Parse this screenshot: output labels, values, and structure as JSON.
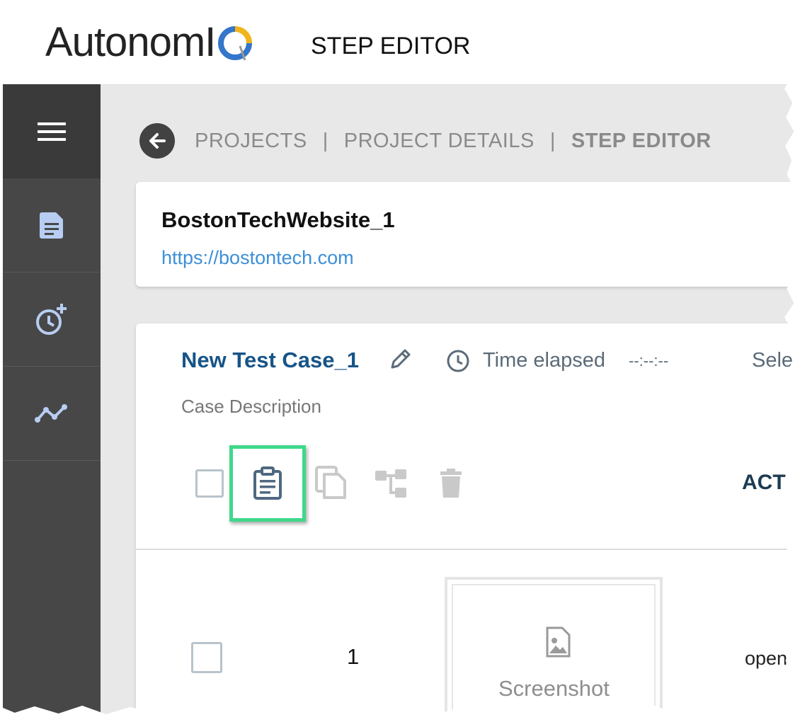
{
  "header": {
    "logo_text": "AutonomI",
    "logo_q": "Q",
    "title": "STEP EDITOR"
  },
  "sidebar": {
    "items": [
      {
        "icon": "menu-icon"
      },
      {
        "icon": "document-icon"
      },
      {
        "icon": "schedule-add-icon"
      },
      {
        "icon": "trend-chart-icon"
      }
    ],
    "active_icon_color": "#b7cdf2"
  },
  "breadcrumb": {
    "items": [
      "PROJECTS",
      "PROJECT DETAILS",
      "STEP EDITOR"
    ],
    "separator": "|"
  },
  "project": {
    "name": "BostonTechWebsite_1",
    "url": "https://bostontech.com"
  },
  "test_case": {
    "title": "New Test Case_1",
    "time_label": "Time elapsed",
    "time_value": "--:--:--",
    "select_label_partial": "Sele",
    "description": "Case Description"
  },
  "toolbar": {
    "actions_label_partial": "ACT",
    "highlight_color": "#3fd88a"
  },
  "steps": [
    {
      "number": "1",
      "screenshot_label": "Screenshot",
      "action_partial": "open"
    }
  ]
}
